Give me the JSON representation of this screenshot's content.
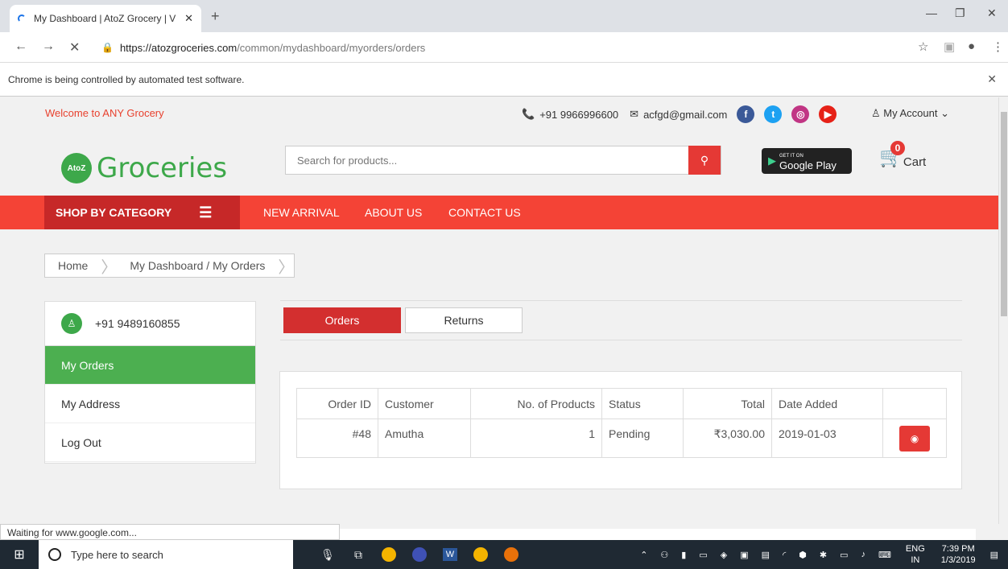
{
  "browser": {
    "tab_title": "My Dashboard | AtoZ Grocery | V",
    "tab_close": "✕",
    "new_tab": "+",
    "url_host": "https://atozgroceries.com",
    "url_path": "/common/mydashboard/myorders/orders",
    "infobar_text": "Chrome is being controlled by automated test software.",
    "status_text": "Waiting for www.google.com..."
  },
  "topbar": {
    "welcome": "Welcome to ANY Grocery",
    "phone": "+91 9966996600",
    "email": "acfgd@gmail.com",
    "account": "My Account"
  },
  "header": {
    "logo_badge": "AtoZ",
    "logo_text": "Groceries",
    "search_placeholder": "Search for products...",
    "gplay_small": "GET IT ON",
    "gplay_label": "Google Play",
    "cart_count": "0",
    "cart_label": "Cart"
  },
  "menu": {
    "shop_by_category": "SHOP BY CATEGORY",
    "items": [
      "NEW ARRIVAL",
      "ABOUT US",
      "CONTACT US"
    ]
  },
  "breadcrumb": {
    "home": "Home",
    "current": "My Dashboard / My Orders"
  },
  "sidebar": {
    "phone": "+91 9489160855",
    "items": [
      "My Orders",
      "My Address",
      "Log Out"
    ]
  },
  "tabs": {
    "orders": "Orders",
    "returns": "Returns"
  },
  "orders_table": {
    "headers": [
      "Order ID",
      "Customer",
      "No. of Products",
      "Status",
      "Total",
      "Date Added"
    ],
    "rows": [
      {
        "order_id": "#48",
        "customer": "Amutha",
        "products": "1",
        "status": "Pending",
        "total": "₹3,030.00",
        "date": "2019-01-03"
      }
    ]
  },
  "taskbar": {
    "search_placeholder": "Type here to search",
    "lang_top": "ENG",
    "lang_bottom": "IN",
    "time": "7:39 PM",
    "date": "1/3/2019"
  },
  "colors": {
    "accent_red": "#f44336",
    "dark_red": "#c62828",
    "green": "#4caf50"
  }
}
